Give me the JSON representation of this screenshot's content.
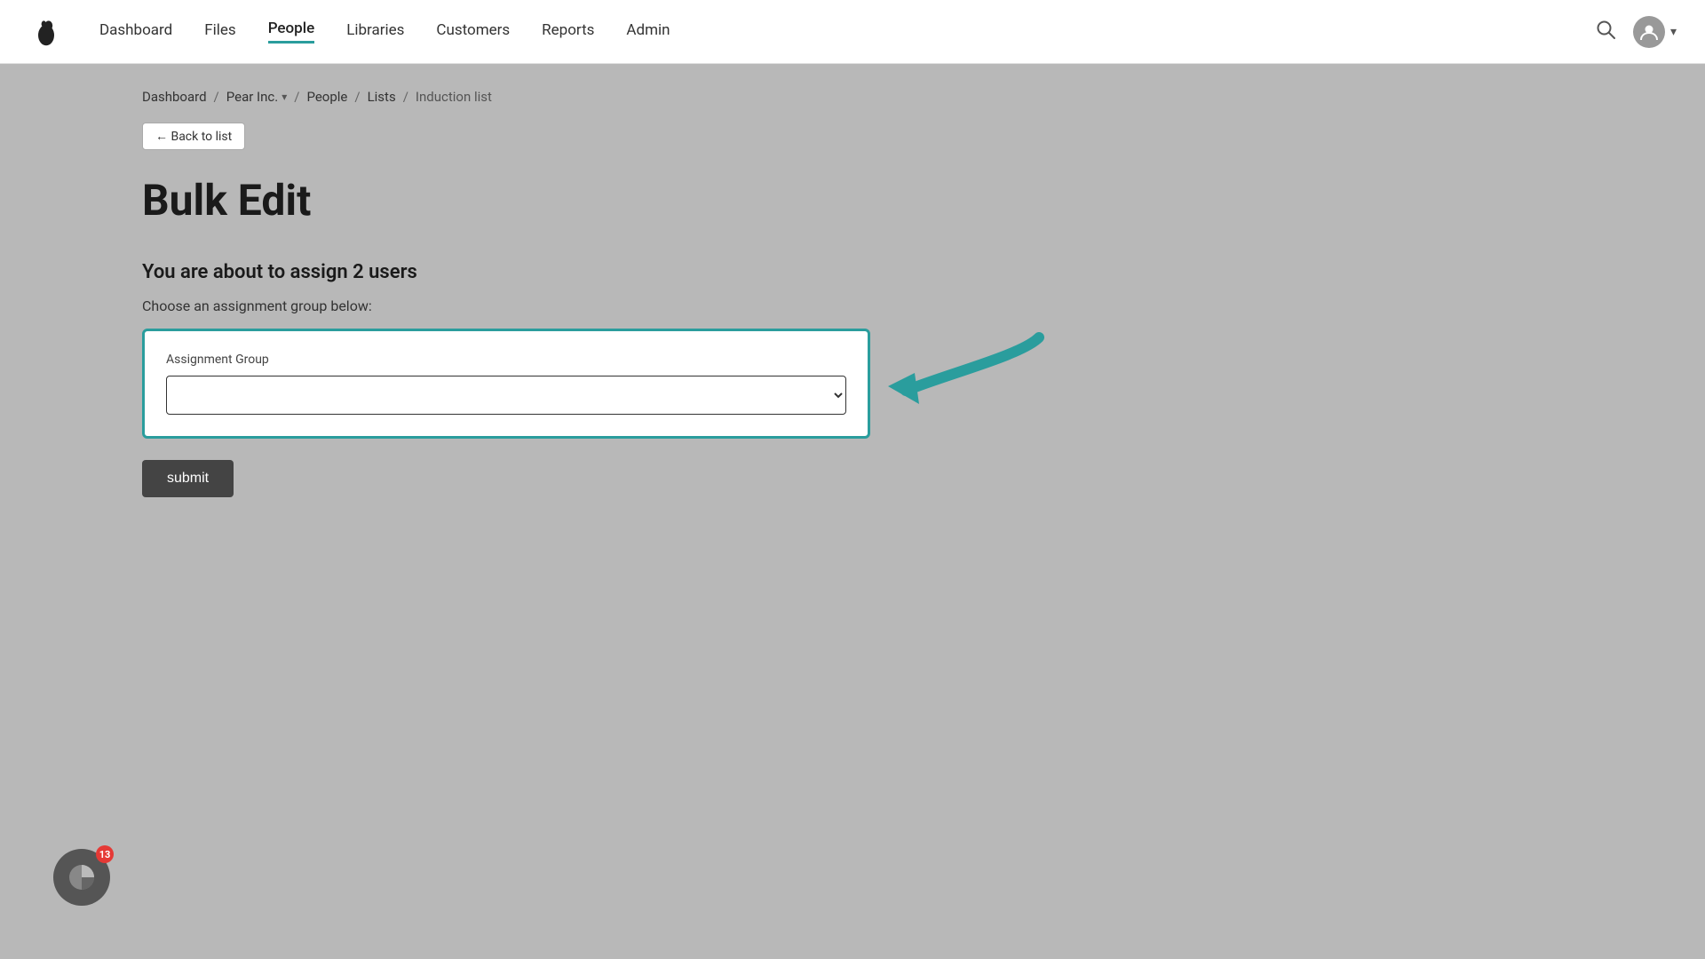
{
  "navbar": {
    "logo_alt": "App Logo",
    "links": [
      {
        "label": "Dashboard",
        "active": false
      },
      {
        "label": "Files",
        "active": false
      },
      {
        "label": "People",
        "active": true
      },
      {
        "label": "Libraries",
        "active": false
      },
      {
        "label": "Customers",
        "active": false
      },
      {
        "label": "Reports",
        "active": false
      },
      {
        "label": "Admin",
        "active": false
      }
    ],
    "search_icon": "🔍",
    "user_icon": "👤"
  },
  "breadcrumb": {
    "items": [
      "Dashboard",
      "Pear Inc.",
      "People",
      "Lists",
      "Induction list"
    ]
  },
  "back_button": {
    "label": "← Back to list"
  },
  "page": {
    "title": "Bulk Edit",
    "section_heading": "You are about to assign 2 users",
    "assignment_label": "Choose an assignment group below:",
    "assignment_group_field_label": "Assignment Group",
    "assignment_group_placeholder": "",
    "submit_label": "submit"
  },
  "widget": {
    "badge_count": "13"
  }
}
